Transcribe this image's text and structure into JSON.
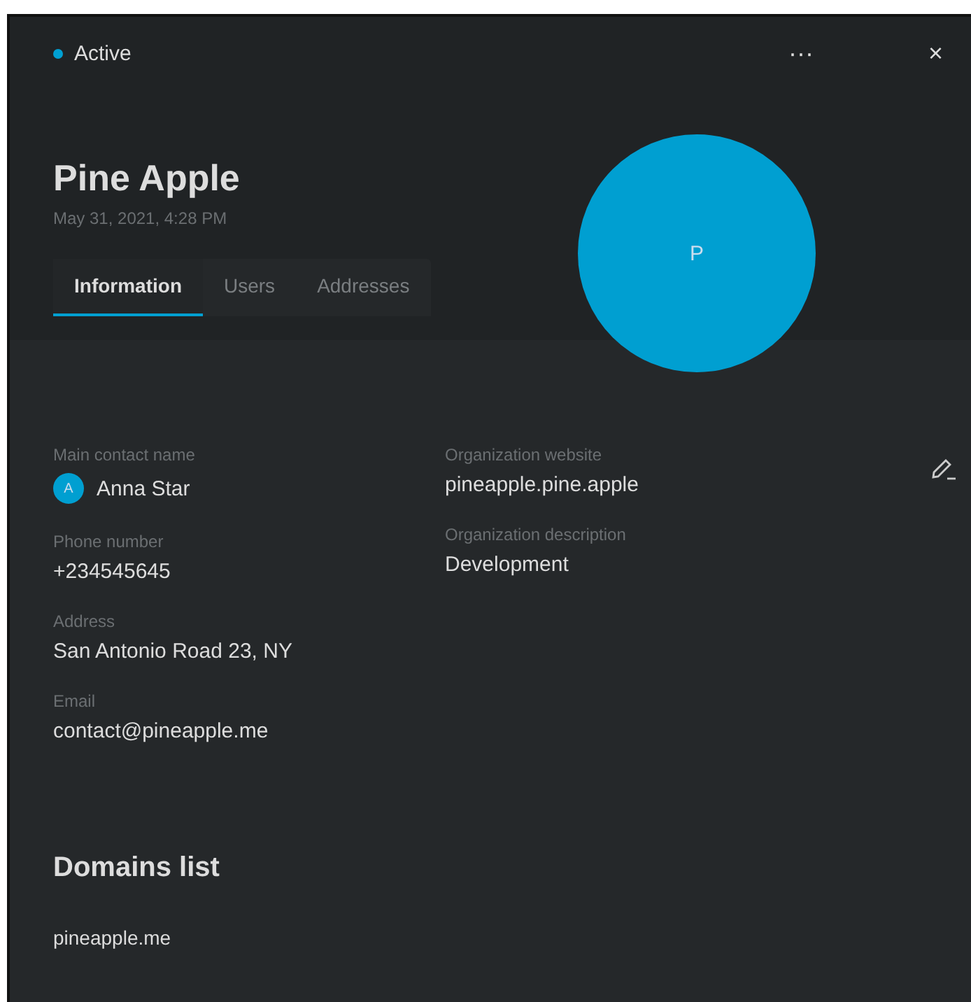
{
  "status": {
    "label": "Active",
    "color": "#00a0d2"
  },
  "menu": "···",
  "close": "×",
  "title": "Pine Apple",
  "date": "May 31, 2021, 4:28 PM",
  "avatar": {
    "initial": "P"
  },
  "tabs": [
    {
      "label": "Information",
      "selected": true
    },
    {
      "label": "Users",
      "selected": false
    },
    {
      "label": "Addresses",
      "selected": false
    }
  ],
  "field_columns": [
    [
      {
        "label": "Main contact name",
        "value": "Anna Star",
        "avatar": "A"
      },
      {
        "label": "Phone number",
        "value": "+234545645"
      },
      {
        "label": "Address",
        "value": "San Antonio Road 23, NY"
      },
      {
        "label": "Email",
        "value": "contact@pineapple.me"
      }
    ],
    [
      {
        "label": "Organization website",
        "value": "pineapple.pine.apple"
      },
      {
        "label": "Organization description",
        "value": "Development"
      }
    ]
  ],
  "domains": {
    "title": "Domains list",
    "items": [
      "pineapple.me"
    ]
  }
}
